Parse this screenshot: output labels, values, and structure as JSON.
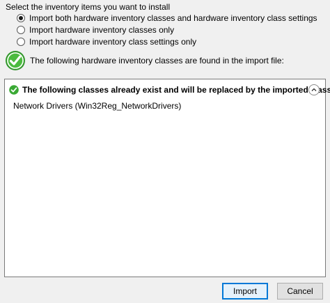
{
  "intro_text": "Select the inventory items you want to install",
  "options": [
    {
      "label": "Import both hardware inventory classes and hardware inventory class settings",
      "checked": true
    },
    {
      "label": "Import hardware inventory classes only",
      "checked": false
    },
    {
      "label": "Import hardware inventory class settings only",
      "checked": false
    }
  ],
  "found_text": "The following hardware inventory classes are found in the import file:",
  "panel": {
    "header": "The following classes already exist and will be replaced by the imported class:",
    "items": [
      "Network Drivers (Win32Reg_NetworkDrivers)"
    ]
  },
  "buttons": {
    "import_label": "Import",
    "cancel_label": "Cancel"
  },
  "colors": {
    "success_green": "#3aa934",
    "accent_blue": "#0078d7"
  },
  "icons": {
    "status": "checkmark-circle-icon",
    "collapse": "chevron-up-icon"
  }
}
